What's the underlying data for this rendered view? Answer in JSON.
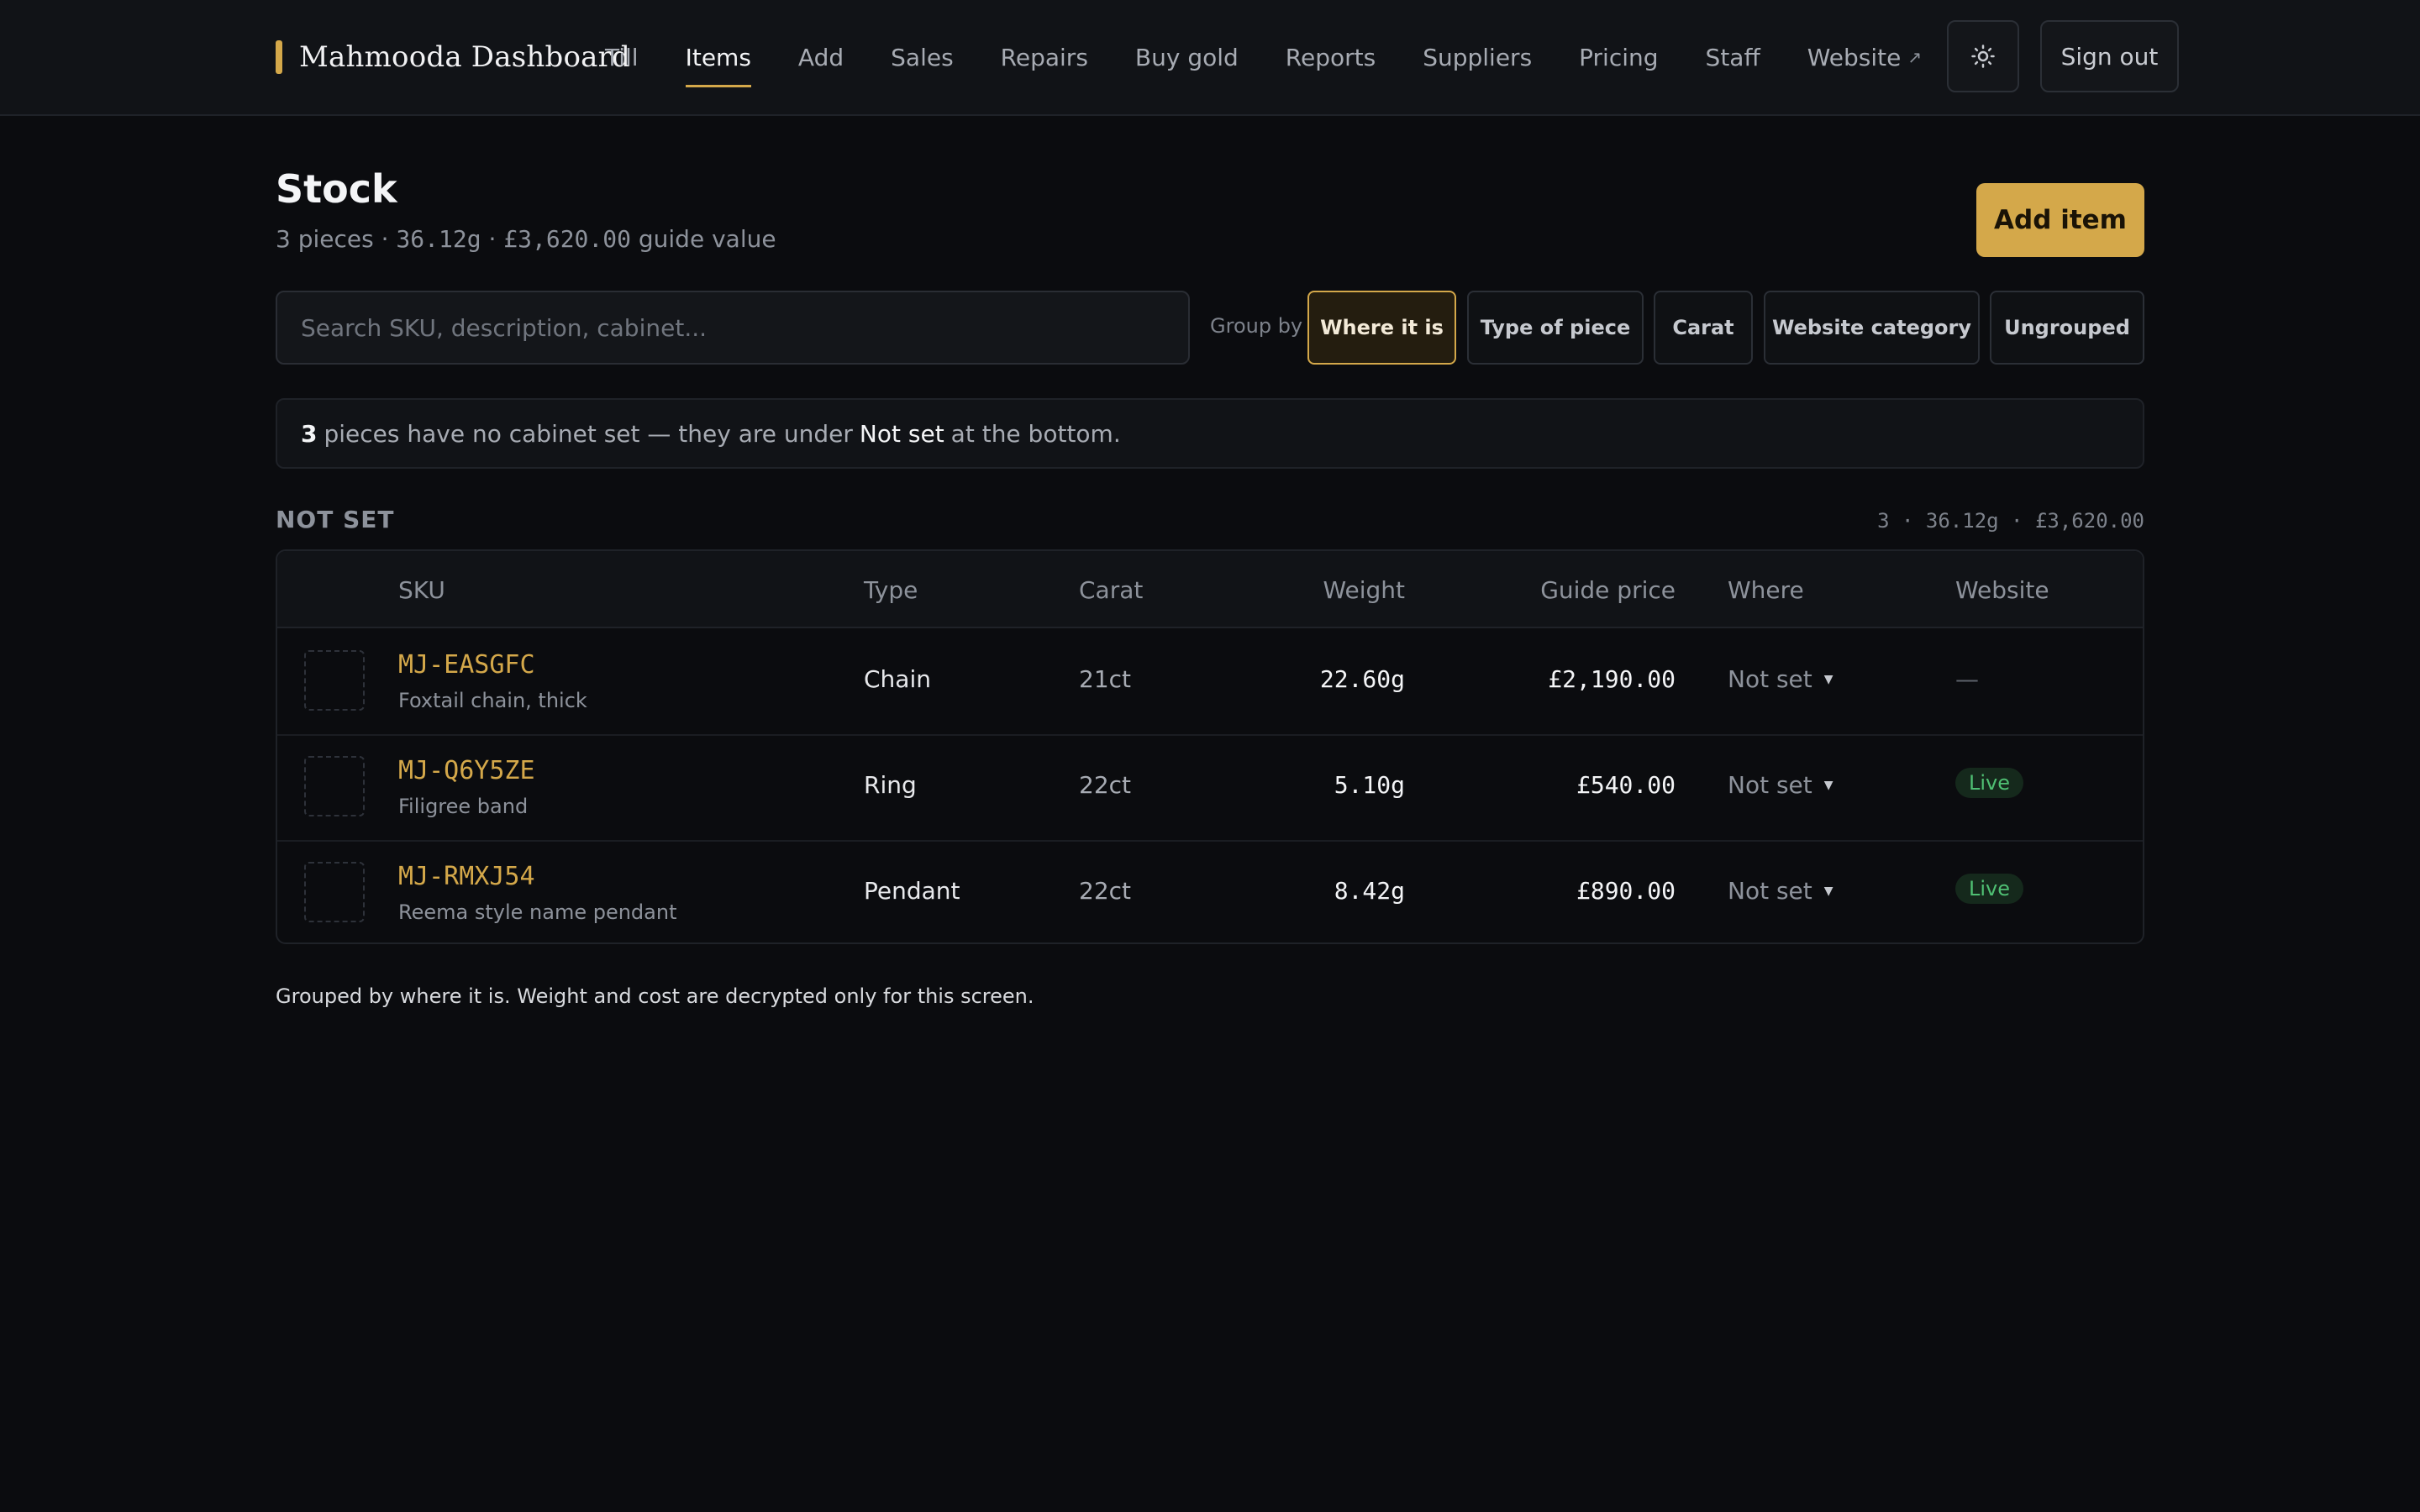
{
  "header": {
    "brand": "Mahmooda Dashboard",
    "nav": [
      "Till",
      "Items",
      "Add",
      "Sales",
      "Repairs",
      "Buy gold",
      "Reports",
      "Suppliers",
      "Pricing",
      "Staff",
      "Website"
    ],
    "website_arrow": "↗",
    "theme_icon": "sun-icon",
    "signout": "Sign out"
  },
  "page": {
    "title": "Stock",
    "subtitle_count": "3 pieces · ",
    "subtitle_weight": "36.12g",
    "subtitle_sep": " · ",
    "subtitle_value": "£3,620.00",
    "subtitle_tail": " guide value",
    "add_button": "Add item"
  },
  "search": {
    "placeholder": "Search SKU, description, cabinet..."
  },
  "group_by": {
    "label": "Group by",
    "options": [
      "Where it is",
      "Type of piece",
      "Carat",
      "Website category",
      "Ungrouped"
    ],
    "selected": "Where it is"
  },
  "notice": {
    "count": "3",
    "text_a": "pieces have no cabinet set — they are under",
    "highlight": "Not set",
    "text_b": "at the bottom."
  },
  "group": {
    "name": "NOT SET",
    "summary": "3 · 36.12g · £3,620.00"
  },
  "table": {
    "columns": [
      "SKU",
      "Type",
      "Carat",
      "Weight",
      "Guide price",
      "Where",
      "Website"
    ],
    "rows": [
      {
        "sku": "MJ-EASGFC",
        "desc": "Foxtail chain, thick",
        "type": "Chain",
        "carat": "21ct",
        "weight": "22.60g",
        "price": "£2,190.00",
        "where": "Not set",
        "website": "—"
      },
      {
        "sku": "MJ-Q6Y5ZE",
        "desc": "Filigree band",
        "type": "Ring",
        "carat": "22ct",
        "weight": "5.10g",
        "price": "£540.00",
        "where": "Not set",
        "website": "Live"
      },
      {
        "sku": "MJ-RMXJ54",
        "desc": "Reema style name pendant",
        "type": "Pendant",
        "carat": "22ct",
        "weight": "8.42g",
        "price": "£890.00",
        "where": "Not set",
        "website": "Live"
      }
    ]
  },
  "footnote": "Grouped by where it is. Weight and cost are decrypted only for this screen.",
  "colors": {
    "accent": "#d4a84a",
    "background": "#0b0c0f",
    "live": "#4fbf73"
  }
}
